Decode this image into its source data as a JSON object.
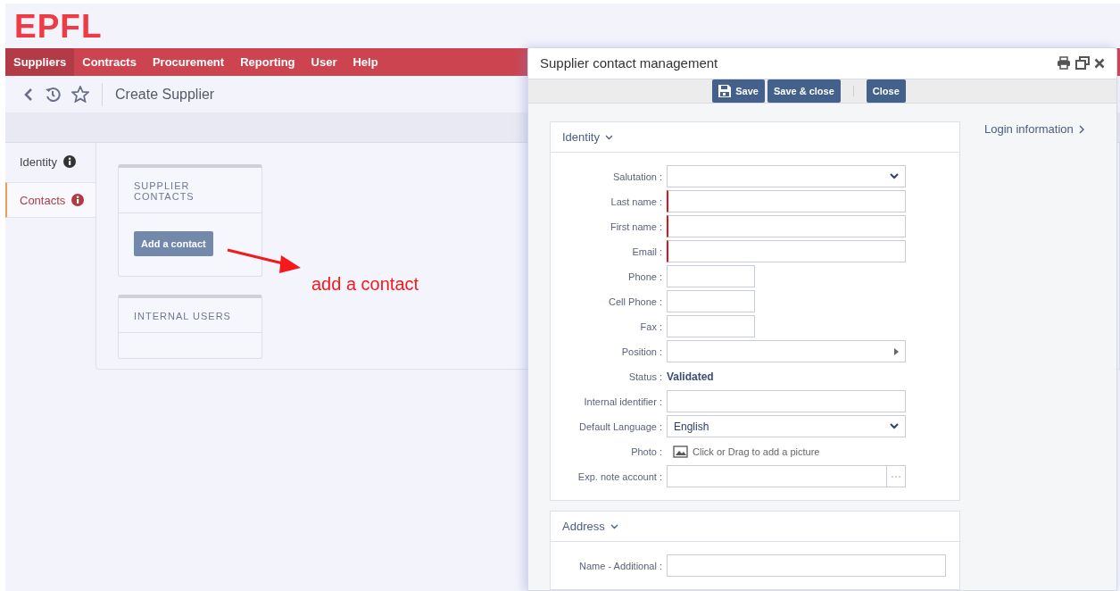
{
  "logo": "EPFL",
  "menu": [
    {
      "label": "Suppliers",
      "selected": true
    },
    {
      "label": "Contracts",
      "selected": false
    },
    {
      "label": "Procurement",
      "selected": false
    },
    {
      "label": "Reporting",
      "selected": false
    },
    {
      "label": "User",
      "selected": false
    },
    {
      "label": "Help",
      "selected": false
    }
  ],
  "page_title": "Create Supplier",
  "side_tabs": [
    {
      "label": "Identity",
      "selected": false
    },
    {
      "label": "Contacts",
      "selected": true
    }
  ],
  "cards": [
    {
      "title": "SUPPLIER CONTACTS",
      "button": "Add a contact"
    },
    {
      "title": "INTERNAL USERS"
    }
  ],
  "annotation": "add a contact",
  "dialog": {
    "title": "Supplier contact management",
    "button_groups": [
      [
        {
          "label": "Save",
          "kind": "icon"
        },
        {
          "label": "Save & close",
          "kind": "plain"
        }
      ],
      [
        {
          "label": "Close",
          "kind": "plain"
        }
      ]
    ],
    "side_link": "Login information",
    "sections": [
      {
        "title": "Identity",
        "fields": [
          {
            "label": "Salutation :",
            "kind": "select",
            "required": false
          },
          {
            "label": "Last name :",
            "kind": "text",
            "required": true
          },
          {
            "label": "First name :",
            "kind": "text",
            "required": true
          },
          {
            "label": "Email :",
            "kind": "text",
            "required": true
          },
          {
            "label": "Phone :",
            "kind": "short",
            "required": false
          },
          {
            "label": "Cell Phone :",
            "kind": "short",
            "required": false
          },
          {
            "label": "Fax :",
            "kind": "short",
            "required": false
          },
          {
            "label": "Position :",
            "kind": "picker",
            "required": false
          },
          {
            "label": "Status :",
            "kind": "status",
            "value": "Validated"
          },
          {
            "label": "Internal identifier :",
            "kind": "text",
            "required": false
          },
          {
            "label": "Default Language :",
            "kind": "select",
            "value": "English",
            "required": false
          },
          {
            "label": "Photo :",
            "kind": "photo",
            "value": "Click or Drag to add a picture"
          },
          {
            "label": "Exp. note account :",
            "kind": "browse",
            "required": false
          }
        ]
      },
      {
        "title": "Address",
        "fields": [
          {
            "label": "Name - Additional :",
            "kind": "wide",
            "required": false
          }
        ]
      }
    ]
  }
}
